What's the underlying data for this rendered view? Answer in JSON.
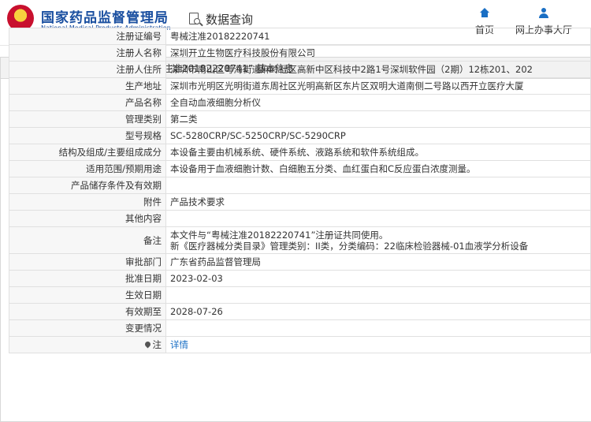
{
  "header": {
    "logo_cn": "国家药品监督管理局",
    "logo_en": "National Medical Products Administration",
    "data_query": "数据查询",
    "nav": [
      {
        "label": "首页",
        "icon": "home-icon"
      },
      {
        "label": "网上办事大厅",
        "icon": "user-icon"
      }
    ]
  },
  "panel": {
    "title": "境内医疗器械（注册） —— “粤械注准20182220741” 基本信息"
  },
  "rows": [
    {
      "label": "注册证编号",
      "value": "粤械注准20182220741"
    },
    {
      "label": "注册人名称",
      "value": "深圳开立生物医疗科技股份有限公司"
    },
    {
      "label": "注册人住所",
      "value": "深圳市南山区粤海街道麻岭社区高新中区科技中2路1号深圳软件园（2期）12栋201、202"
    },
    {
      "label": "生产地址",
      "value": "深圳市光明区光明街道东周社区光明高新区东片区双明大道南侧二号路以西开立医疗大厦"
    },
    {
      "label": "产品名称",
      "value": "全自动血液细胞分析仪"
    },
    {
      "label": "管理类别",
      "value": "第二类"
    },
    {
      "label": "型号规格",
      "value": "SC-5280CRP/SC-5250CRP/SC-5290CRP"
    },
    {
      "label": "结构及组成/主要组成成分",
      "value": "本设备主要由机械系统、硬件系统、液路系统和软件系统组成。"
    },
    {
      "label": "适用范围/预期用途",
      "value": "本设备用于血液细胞计数、白细胞五分类、血红蛋白和C反应蛋白浓度测量。"
    },
    {
      "label": "产品储存条件及有效期",
      "value": ""
    },
    {
      "label": "附件",
      "value": "产品技术要求"
    },
    {
      "label": "其他内容",
      "value": ""
    },
    {
      "label": "备注",
      "value_line1": "本文件与“粤械注准20182220741”注册证共同使用。",
      "value_line2": "新《医疗器械分类目录》管理类别：II类，分类编码：22临床检验器械-01血液学分析设备"
    },
    {
      "label": "审批部门",
      "value": "广东省药品监督管理局"
    },
    {
      "label": "批准日期",
      "value": "2023-02-03"
    },
    {
      "label": "生效日期",
      "value": ""
    },
    {
      "label": "有效期至",
      "value": "2028-07-26"
    },
    {
      "label": "变更情况",
      "value": ""
    },
    {
      "label": "注",
      "value": "详情"
    }
  ]
}
